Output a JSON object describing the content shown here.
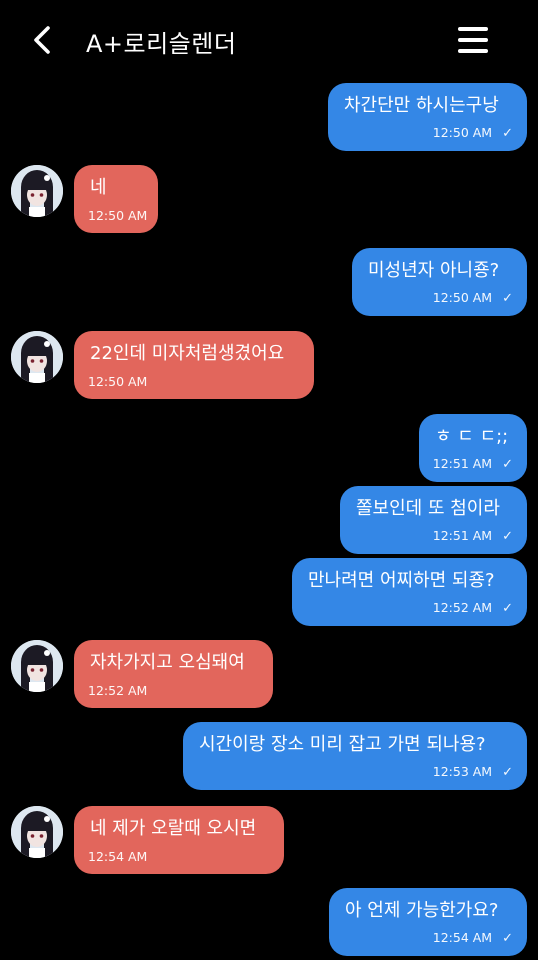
{
  "header": {
    "title": "A+로리슬렌더",
    "back_icon": "chevron-left-icon",
    "menu_icon": "hamburger-menu-icon"
  },
  "colors": {
    "background": "#000000",
    "outgoing_bubble": "#3487e6",
    "incoming_bubble": "#e2665c",
    "text": "#ffffff"
  },
  "messages": [
    {
      "dir": "out",
      "text": "차간단만 하시는구낭",
      "time": "12:50 AM",
      "check": "✓"
    },
    {
      "dir": "in",
      "text": "네",
      "time": "12:50 AM"
    },
    {
      "dir": "out",
      "text": "미성년자 아니죵?",
      "time": "12:50 AM",
      "check": "✓"
    },
    {
      "dir": "in",
      "text": "22인데 미자처럼생겼어요",
      "time": "12:50 AM"
    },
    {
      "dir": "out",
      "text": "ㅎ ㄷ ㄷ;;",
      "time": "12:51 AM",
      "check": "✓"
    },
    {
      "dir": "out",
      "text": "쫄보인데 또 첨이라",
      "time": "12:51 AM",
      "check": "✓"
    },
    {
      "dir": "out",
      "text": "만나려면 어찌하면 되죵?",
      "time": "12:52 AM",
      "check": "✓"
    },
    {
      "dir": "in",
      "text": "자차가지고 오심돼여",
      "time": "12:52 AM"
    },
    {
      "dir": "out",
      "text": "시간이랑 장소 미리 잡고 가면 되나용?",
      "time": "12:53 AM",
      "check": "✓"
    },
    {
      "dir": "in",
      "text": "네 제가 오랄때 오시면",
      "time": "12:54 AM"
    },
    {
      "dir": "out",
      "text": "아 언제 가능한가요?",
      "time": "12:54 AM",
      "check": "✓"
    }
  ]
}
